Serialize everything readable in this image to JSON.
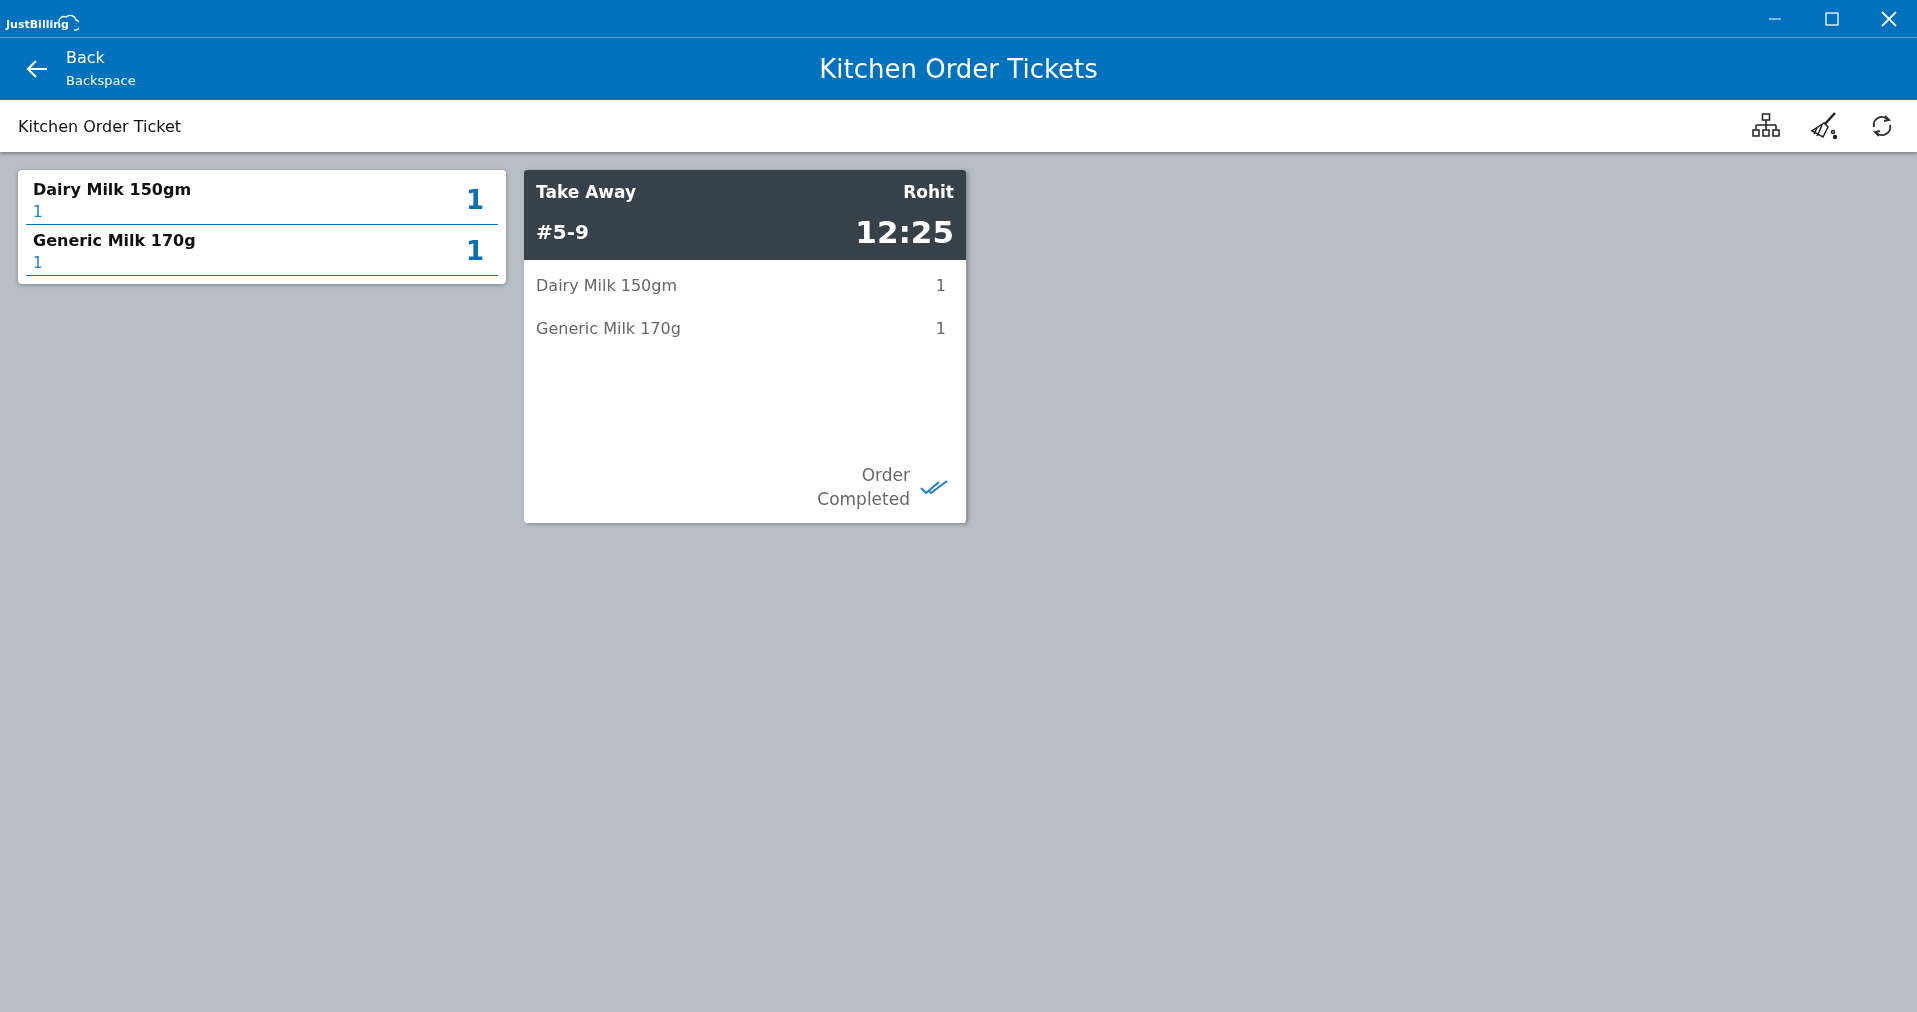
{
  "app": {
    "logo": "JustBilling"
  },
  "header": {
    "back_label": "Back",
    "back_shortcut": "Backspace",
    "title": "Kitchen Order Tickets"
  },
  "toolbar": {
    "title": "Kitchen Order Ticket"
  },
  "summary": [
    {
      "name": "Dairy Milk 150gm",
      "sub_quantity": "1",
      "quantity": "1"
    },
    {
      "name": "Generic Milk 170g",
      "sub_quantity": "1",
      "quantity": "1"
    }
  ],
  "tickets": [
    {
      "order_type": "Take Away",
      "waiter": "Rohit",
      "number": "#5-9",
      "time": "12:25",
      "items": [
        {
          "name": "Dairy Milk 150gm",
          "quantity": "1"
        },
        {
          "name": "Generic Milk 170g",
          "quantity": "1"
        }
      ],
      "status": "Order Completed"
    }
  ]
}
